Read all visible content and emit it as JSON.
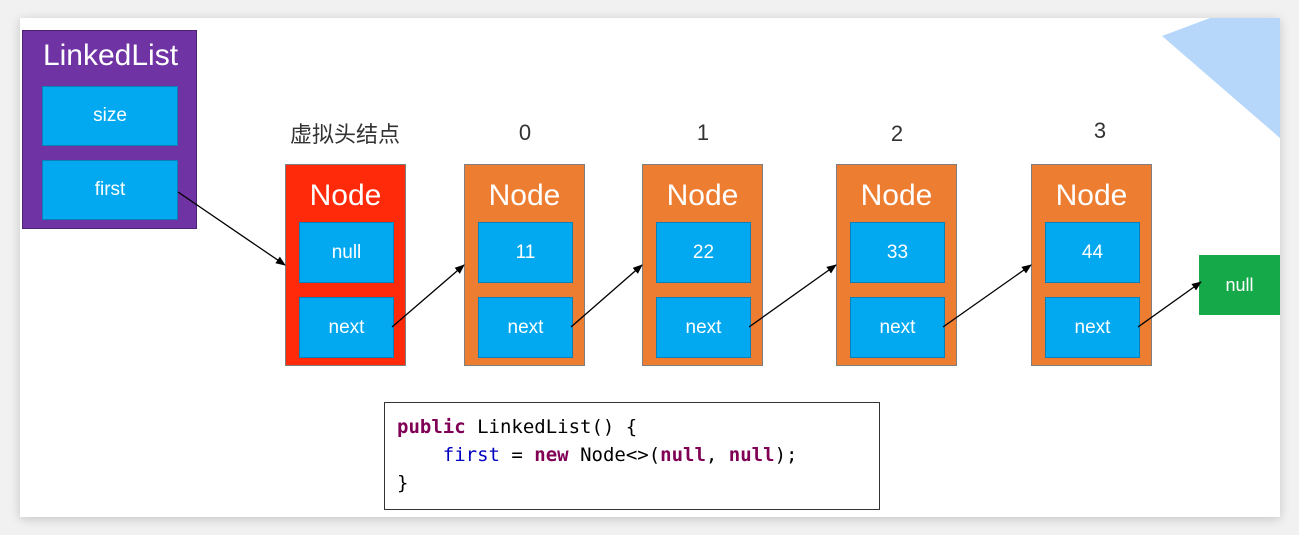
{
  "linked_list": {
    "title": "LinkedList",
    "fields": [
      "size",
      "first"
    ]
  },
  "dummy_head_label": "虚拟头结点",
  "nodes": [
    {
      "index_label": "",
      "title": "Node",
      "value": "null",
      "next": "next",
      "color": "#ff2a0a"
    },
    {
      "index_label": "0",
      "title": "Node",
      "value": "11",
      "next": "next",
      "color": "#ed7d31"
    },
    {
      "index_label": "1",
      "title": "Node",
      "value": "22",
      "next": "next",
      "color": "#ed7d31"
    },
    {
      "index_label": "2",
      "title": "Node",
      "value": "33",
      "next": "next",
      "color": "#ed7d31"
    },
    {
      "index_label": "3",
      "title": "Node",
      "value": "44",
      "next": "next",
      "color": "#ed7d31"
    }
  ],
  "tail_null": "null",
  "code": {
    "line1": {
      "kw": "public",
      "rest": " LinkedList() {"
    },
    "line2": {
      "field": "first",
      "eq": " = ",
      "kw_new": "new",
      "mid": " Node<>(",
      "null1": "null",
      "comma": ", ",
      "null2": "null",
      "end": ");"
    },
    "line3": "}"
  },
  "colors": {
    "linkedlist_bg": "#6f33a3",
    "cell_blue": "#03a9f0",
    "dummy_node": "#ff2a0a",
    "node_orange": "#ed7d31",
    "null_green": "#16a94a",
    "keyword": "#7f0055",
    "field": "#0000c0"
  }
}
